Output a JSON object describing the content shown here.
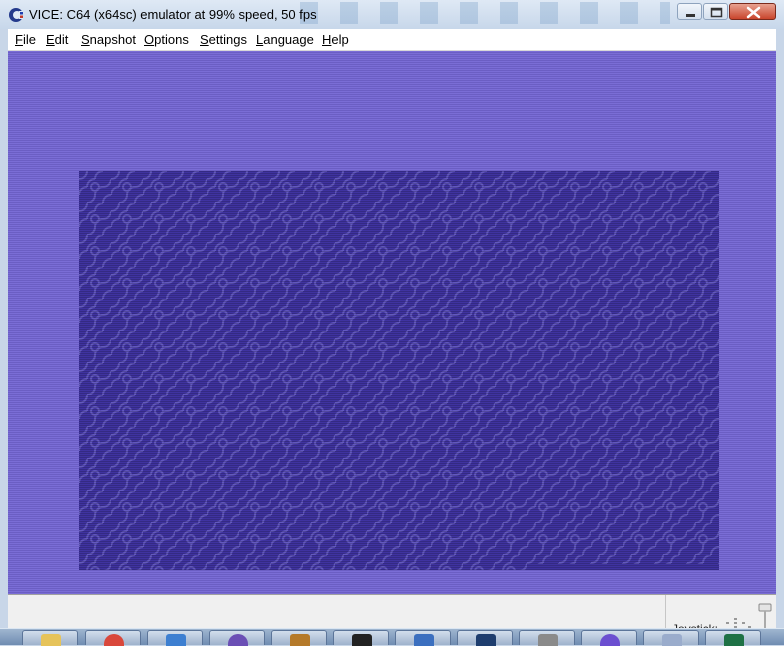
{
  "window": {
    "title": "VICE: C64 (x64sc) emulator at 99% speed, 50 fps"
  },
  "menu": {
    "items": [
      {
        "label": "File",
        "accel": "F"
      },
      {
        "label": "Edit",
        "accel": "E"
      },
      {
        "label": "Snapshot",
        "accel": "S"
      },
      {
        "label": "Options",
        "accel": "O"
      },
      {
        "label": "Settings",
        "accel": "S"
      },
      {
        "label": "Language",
        "accel": "L"
      },
      {
        "label": "Help",
        "accel": "H"
      }
    ]
  },
  "screen": {
    "border_color": "#6f62cc",
    "background_color": "#3f33a0",
    "pattern_color": "#6a5fc6"
  },
  "status": {
    "joystick_label": "Joystick:"
  },
  "taskbar": {
    "apps": [
      {
        "name": "explorer-icon",
        "color": "#e6c35a"
      },
      {
        "name": "chrome-icon",
        "color": "#d9473b"
      },
      {
        "name": "window-icon",
        "color": "#3d7fd1"
      },
      {
        "name": "mail-icon",
        "color": "#6b4fb5"
      },
      {
        "name": "sublime-icon",
        "color": "#b57a2a"
      },
      {
        "name": "terminal-icon",
        "color": "#222222"
      },
      {
        "name": "folder-icon",
        "color": "#3b6fbf"
      },
      {
        "name": "photoshop-icon",
        "color": "#1e3d6e"
      },
      {
        "name": "app-icon",
        "color": "#8a8a8a"
      },
      {
        "name": "word-icon",
        "color": "#2b5797"
      },
      {
        "name": "eye-icon",
        "color": "#6b4fd0"
      },
      {
        "name": "misc-icon",
        "color": "#9aaccc"
      },
      {
        "name": "excel-icon",
        "color": "#1e7145"
      }
    ]
  }
}
